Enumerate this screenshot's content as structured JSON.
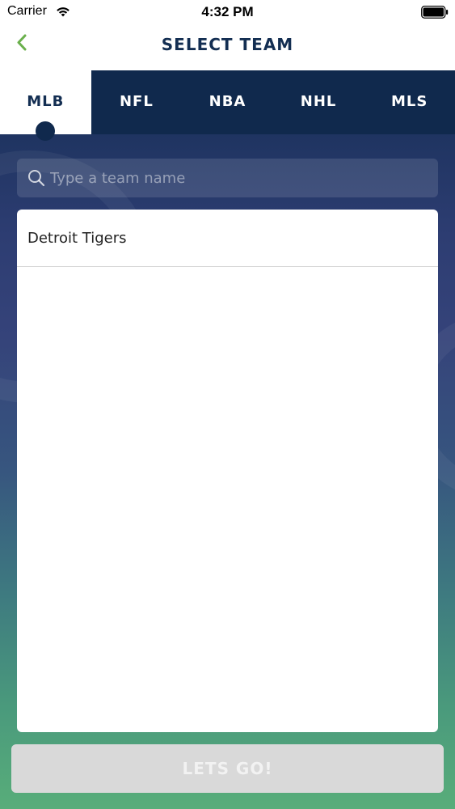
{
  "status_bar": {
    "carrier": "Carrier",
    "time": "4:32 PM",
    "icons": [
      "wifi-icon",
      "battery-icon"
    ]
  },
  "nav": {
    "title": "SELECT TEAM",
    "back_icon": "chevron-left-icon",
    "accent_color": "#6ab04c"
  },
  "tabs": [
    {
      "label": "MLB",
      "active": true
    },
    {
      "label": "NFL",
      "active": false
    },
    {
      "label": "NBA",
      "active": false
    },
    {
      "label": "NHL",
      "active": false
    },
    {
      "label": "MLS",
      "active": false
    }
  ],
  "search": {
    "placeholder": "Type a team name",
    "value": "",
    "icon": "search-icon"
  },
  "team_list": {
    "items": [
      "Detroit Tigers"
    ]
  },
  "action": {
    "label": "LETS GO!",
    "enabled": false
  },
  "colors": {
    "navy": "#10294d",
    "title": "#132e52",
    "back_arrow": "#6ab04c",
    "button_disabled": "#d9d9d9"
  }
}
